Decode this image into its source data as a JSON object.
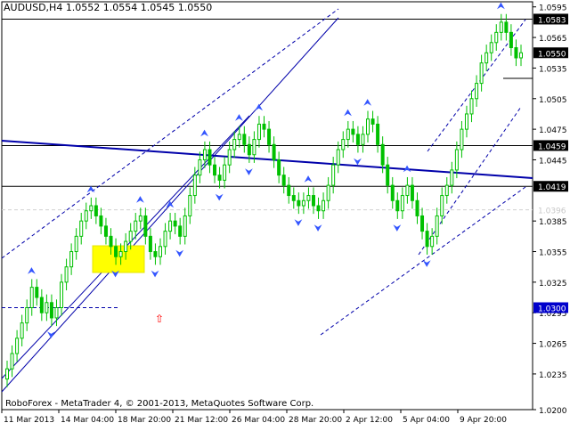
{
  "header": {
    "title": "AUDUSD,H4  1.0552 1.0554 1.0545 1.0550"
  },
  "footer": {
    "watermark": "RoboForex - MetaTrader 4, © 2001-2013, MetaQuotes Software Corp."
  },
  "chart_data": {
    "type": "candlestick",
    "symbol": "AUDUSD",
    "timeframe": "H4",
    "ylim": [
      1.02,
      1.06
    ],
    "y_ticks": [
      "1.0595",
      "1.0565",
      "1.0535",
      "1.0505",
      "1.0475",
      "1.0445",
      "1.0385",
      "1.0355",
      "1.0325",
      "1.0295",
      "1.0265",
      "1.0235",
      "1.0200"
    ],
    "x_ticks": [
      "11 Mar 2013",
      "14 Mar 04:00",
      "18 Mar 20:00",
      "21 Mar 12:00",
      "26 Mar 04:00",
      "28 Mar 20:00",
      "2 Apr 12:00",
      "5 Apr 04:00",
      "9 Apr 20:00"
    ],
    "price_labels": [
      {
        "value": "1.0583",
        "price": 1.0583,
        "style": "highlight"
      },
      {
        "value": "1.0550",
        "price": 1.055,
        "style": "highlight"
      },
      {
        "value": "1.0459",
        "price": 1.0459,
        "style": "highlight"
      },
      {
        "value": "1.0419",
        "price": 1.0419,
        "style": "highlight"
      },
      {
        "value": "1.0396",
        "price": 1.0396,
        "style": "faded"
      },
      {
        "value": "1.0300",
        "price": 1.03,
        "style": "blue"
      }
    ],
    "closes": [
      1.024,
      1.0255,
      1.027,
      1.0285,
      1.03,
      1.032,
      1.031,
      1.0295,
      1.0305,
      1.029,
      1.03,
      1.0325,
      1.034,
      1.0355,
      1.037,
      1.0385,
      1.0395,
      1.04,
      1.039,
      1.038,
      1.037,
      1.036,
      1.035,
      1.0355,
      1.0365,
      1.0375,
      1.0385,
      1.039,
      1.037,
      1.0355,
      1.035,
      1.036,
      1.0375,
      1.0385,
      1.038,
      1.037,
      1.039,
      1.041,
      1.043,
      1.0445,
      1.0455,
      1.044,
      1.043,
      1.0425,
      1.044,
      1.0455,
      1.0465,
      1.047,
      1.046,
      1.045,
      1.0465,
      1.048,
      1.0475,
      1.046,
      1.0445,
      1.043,
      1.042,
      1.041,
      1.0405,
      1.04,
      1.0405,
      1.041,
      1.04,
      1.0395,
      1.0405,
      1.042,
      1.044,
      1.0455,
      1.0465,
      1.0475,
      1.047,
      1.046,
      1.047,
      1.0485,
      1.048,
      1.046,
      1.044,
      1.042,
      1.0405,
      1.0395,
      1.041,
      1.042,
      1.0405,
      1.039,
      1.0375,
      1.036,
      1.037,
      1.039,
      1.041,
      1.042,
      1.0435,
      1.0455,
      1.0475,
      1.049,
      1.0505,
      1.052,
      1.054,
      1.055,
      1.056,
      1.057,
      1.058,
      1.057,
      1.0555,
      1.0545,
      1.055
    ]
  }
}
